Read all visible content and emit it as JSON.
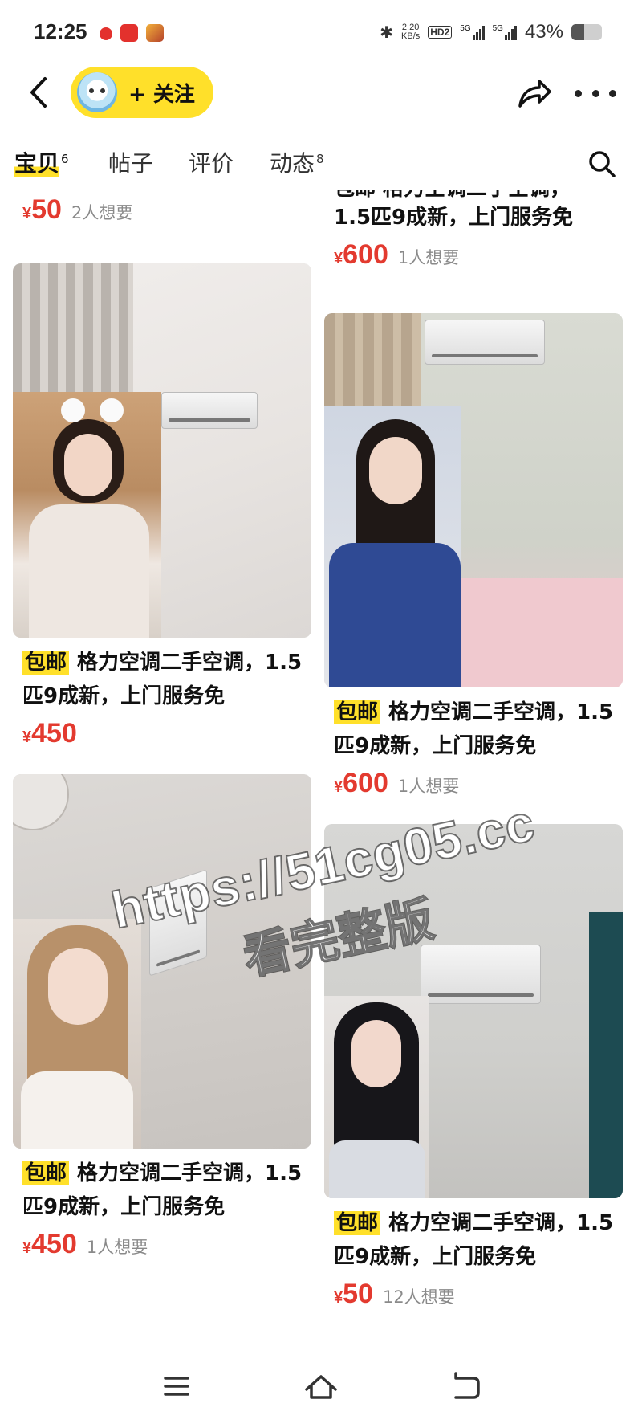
{
  "status_bar": {
    "time": "12:25",
    "net_speed_top": "2.20",
    "net_speed_unit": "KB/s",
    "hd_label": "HD2",
    "signal1_label": "5G",
    "signal2_label": "5G",
    "battery_percent": "43%",
    "battery_level": 0.43
  },
  "header": {
    "follow_label": "+ 关注"
  },
  "tabs": [
    {
      "label": "宝贝",
      "count": "6",
      "active": true
    },
    {
      "label": "帖子",
      "count": "",
      "active": false
    },
    {
      "label": "评价",
      "count": "",
      "active": false
    },
    {
      "label": "动态",
      "count": "8",
      "active": false
    }
  ],
  "feed": {
    "partial_left": {
      "price_symbol": "¥",
      "price": "50",
      "wants": "2人想要"
    },
    "partial_right": {
      "title_line1": "包邮 格力空调二手空调，",
      "title_line2": "1.5匹9成新，上门服务免",
      "price_symbol": "¥",
      "price": "600",
      "wants": "1人想要"
    },
    "cards": [
      {
        "badge": "包邮",
        "title": "格力空调二手空调，1.5匹9成新，上门服务免",
        "price_symbol": "¥",
        "price": "450",
        "wants": ""
      },
      {
        "badge": "包邮",
        "title": "格力空调二手空调，1.5匹9成新，上门服务免",
        "price_symbol": "¥",
        "price": "600",
        "wants": "1人想要"
      },
      {
        "badge": "包邮",
        "title": "格力空调二手空调，1.5匹9成新，上门服务免",
        "price_symbol": "¥",
        "price": "450",
        "wants": "1人想要"
      },
      {
        "badge": "包邮",
        "title": "格力空调二手空调，1.5匹9成新，上门服务免",
        "price_symbol": "¥",
        "price": "50",
        "wants": "12人想要"
      }
    ]
  },
  "watermark": {
    "line1": "https://51cg05.cc",
    "line2": "看完整版"
  },
  "colors": {
    "accent_yellow": "#ffe02a",
    "price_red": "#e33a2f",
    "muted_gray": "#8a8a8a"
  },
  "icons": [
    "back-arrow-icon",
    "share-icon",
    "more-icon",
    "search-icon",
    "menu-icon",
    "home-icon",
    "back-icon"
  ]
}
